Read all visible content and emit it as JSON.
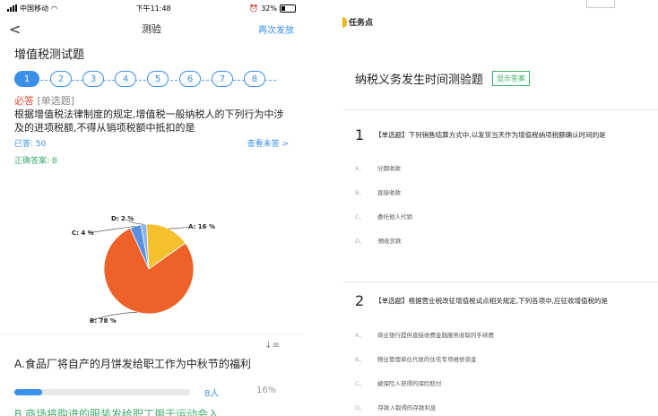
{
  "status_bar": {
    "carrier": "中国移动",
    "time": "下午11:48",
    "battery": "32%",
    "battery_level": 0.32
  },
  "nav": {
    "back": "<",
    "title": "测验",
    "resend": "再次发放"
  },
  "quiz_title": "增值税测试题",
  "steps": [
    "1",
    "2",
    "3",
    "4",
    "5",
    "6",
    "7",
    "8"
  ],
  "question": {
    "required": "必答",
    "type": "[单选题]",
    "text": "根据增值税法律制度的规定,增值税一般纳税人的下列行为中涉及的进项税额,不得从销项税额中抵扣的是",
    "answered": "已答: 50",
    "view_unanswered": "查看未答 >",
    "correct_answer": "正确答案: B"
  },
  "chart_data": {
    "type": "pie",
    "labels": [
      "A: 16 %",
      "B: 78 %",
      "C: 4 %",
      "D: 2 %"
    ],
    "values": [
      16,
      78,
      4,
      2
    ],
    "colors": [
      "#f5c02e",
      "#ee6128",
      "#5b8fe0",
      "#8fb2e8"
    ]
  },
  "option_stats": {
    "sort_icon": "↓≡",
    "option_a": "A.食品厂将自产的月饼发给职工作为中秋节的福利",
    "option_a_count": "8人",
    "option_a_pct": "16%",
    "option_a_fraction": 0.16,
    "option_b_partial": "B.商场将购进的服装发给职工用于运动会入"
  },
  "right": {
    "task_label": "任务点",
    "title": "纳税义务发生时间测验题",
    "show_answer": "显示答案",
    "questions": [
      {
        "num": "1",
        "text": "【单选题】下列销售结算方式中,以发货当天作为增值税纳项税额确认时间的是",
        "options": [
          {
            "letter": "A、",
            "text": "分期收款"
          },
          {
            "letter": "B、",
            "text": "直接收款"
          },
          {
            "letter": "C、",
            "text": "委托他人代销"
          },
          {
            "letter": "D、",
            "text": "预收货款"
          }
        ]
      },
      {
        "num": "2",
        "text": "【单选题】根据营业税改征增值税试点相关规定,下列各项中,应征收增值税的是",
        "options": [
          {
            "letter": "A、",
            "text": "商业银行提供直接收费金融服务收取的手续费"
          },
          {
            "letter": "B、",
            "text": "物业管理单位代收的住宅专项维修资金"
          },
          {
            "letter": "C、",
            "text": "被保险人获得的保险赔付"
          },
          {
            "letter": "D、",
            "text": "存款人取得的存款利息"
          }
        ]
      }
    ]
  }
}
